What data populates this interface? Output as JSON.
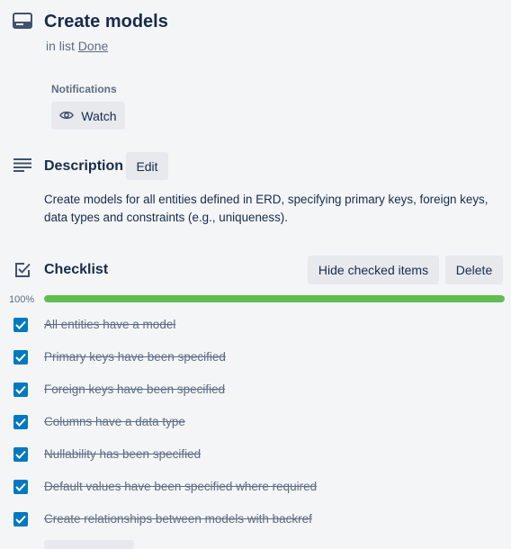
{
  "card": {
    "title": "Create models",
    "in_list_prefix": "in list",
    "list_name": "Done"
  },
  "notifications": {
    "label": "Notifications",
    "watch_label": "Watch"
  },
  "description": {
    "heading": "Description",
    "edit_label": "Edit",
    "text": "Create models for all entities defined in ERD, specifying primary keys, foreign keys, data types and constraints (e.g., uniqueness)."
  },
  "checklist": {
    "heading": "Checklist",
    "hide_checked_label": "Hide checked items",
    "delete_label": "Delete",
    "progress_text": "100%",
    "progress_fraction": 1.0,
    "items": [
      {
        "label": "All entities have a model",
        "checked": true
      },
      {
        "label": "Primary keys have been specified",
        "checked": true
      },
      {
        "label": "Foreign keys have been specified",
        "checked": true
      },
      {
        "label": "Columns have a data type",
        "checked": true
      },
      {
        "label": "Nullability has been specified",
        "checked": true
      },
      {
        "label": "Default values have been specified where required",
        "checked": true
      },
      {
        "label": "Create relationships between models with backref",
        "checked": true
      }
    ]
  },
  "colors": {
    "accent": "#0079bf",
    "progress_complete": "#61bd4f",
    "button_bg": "#e7e9ed"
  },
  "icons": {
    "title": "card-icon",
    "watch": "eye-icon",
    "description": "description-icon",
    "checklist": "checklist-icon",
    "checkbox": "checkmark-icon"
  }
}
